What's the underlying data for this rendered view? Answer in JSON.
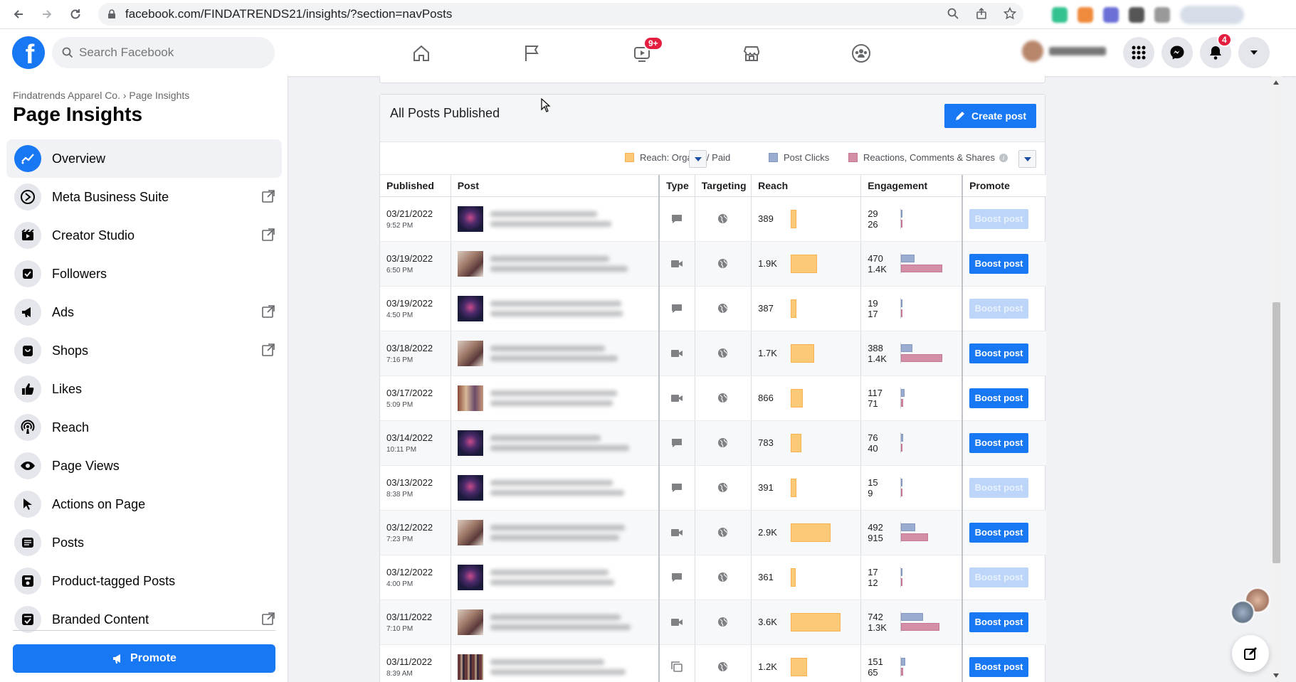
{
  "browser": {
    "url": "facebook.com/FINDATRENDS21/insights/?section=navPosts"
  },
  "topnav": {
    "search_placeholder": "Search Facebook",
    "watch_badge": "9+",
    "notif_badge": "4",
    "logo_letter": "f"
  },
  "sidebar": {
    "breadcrumb": "Findatrends Apparel Co. › Page Insights",
    "title": "Page Insights",
    "items": [
      {
        "label": "Overview",
        "icon": "overview-icon",
        "external": false,
        "active": true
      },
      {
        "label": "Meta Business Suite",
        "icon": "business-suite-icon",
        "external": true,
        "active": false
      },
      {
        "label": "Creator Studio",
        "icon": "creator-studio-icon",
        "external": true,
        "active": false
      },
      {
        "label": "Followers",
        "icon": "followers-icon",
        "external": false,
        "active": false
      },
      {
        "label": "Ads",
        "icon": "megaphone-icon",
        "external": true,
        "active": false
      },
      {
        "label": "Shops",
        "icon": "shop-icon",
        "external": true,
        "active": false
      },
      {
        "label": "Likes",
        "icon": "thumbs-up-icon",
        "external": false,
        "active": false
      },
      {
        "label": "Reach",
        "icon": "reach-icon",
        "external": false,
        "active": false
      },
      {
        "label": "Page Views",
        "icon": "eye-icon",
        "external": false,
        "active": false
      },
      {
        "label": "Actions on Page",
        "icon": "cursor-icon",
        "external": false,
        "active": false
      },
      {
        "label": "Posts",
        "icon": "posts-icon",
        "external": false,
        "active": false
      },
      {
        "label": "Product-tagged Posts",
        "icon": "product-tag-icon",
        "external": false,
        "active": false
      },
      {
        "label": "Branded Content",
        "icon": "branded-content-icon",
        "external": true,
        "active": false
      }
    ],
    "promote_label": "Promote"
  },
  "posts_card": {
    "title": "All Posts Published",
    "create_label": "Create post",
    "legend": {
      "reach": "Reach: Organic / Paid",
      "clicks": "Post Clicks",
      "reactions": "Reactions, Comments & Shares"
    },
    "columns": {
      "published": "Published",
      "post": "Post",
      "type": "Type",
      "targeting": "Targeting",
      "reach": "Reach",
      "engagement": "Engagement",
      "promote": "Promote"
    },
    "boost_label": "Boost post",
    "reach_max": 3600,
    "eng_max": 1400,
    "rows": [
      {
        "date": "03/21/2022",
        "time": "9:52 PM",
        "thumb": "logo",
        "type": "status",
        "reach": "389",
        "reach_val": 389,
        "eng1": "29",
        "eng2": "26",
        "e1": 29,
        "e2": 26,
        "boost_enabled": false
      },
      {
        "date": "03/19/2022",
        "time": "6:50 PM",
        "thumb": "person",
        "type": "video",
        "reach": "1.9K",
        "reach_val": 1900,
        "eng1": "470",
        "eng2": "1.4K",
        "e1": 470,
        "e2": 1400,
        "boost_enabled": true
      },
      {
        "date": "03/19/2022",
        "time": "4:50 PM",
        "thumb": "logo",
        "type": "status",
        "reach": "387",
        "reach_val": 387,
        "eng1": "19",
        "eng2": "17",
        "e1": 19,
        "e2": 17,
        "boost_enabled": false
      },
      {
        "date": "03/18/2022",
        "time": "7:16 PM",
        "thumb": "person",
        "type": "video",
        "reach": "1.7K",
        "reach_val": 1700,
        "eng1": "388",
        "eng2": "1.4K",
        "e1": 388,
        "e2": 1400,
        "boost_enabled": true
      },
      {
        "date": "03/17/2022",
        "time": "5:09 PM",
        "thumb": "group",
        "type": "video",
        "reach": "866",
        "reach_val": 866,
        "eng1": "117",
        "eng2": "71",
        "e1": 117,
        "e2": 71,
        "boost_enabled": true
      },
      {
        "date": "03/14/2022",
        "time": "10:11 PM",
        "thumb": "logo",
        "type": "status",
        "reach": "783",
        "reach_val": 783,
        "eng1": "76",
        "eng2": "40",
        "e1": 76,
        "e2": 40,
        "boost_enabled": true
      },
      {
        "date": "03/13/2022",
        "time": "8:38 PM",
        "thumb": "logo",
        "type": "status",
        "reach": "391",
        "reach_val": 391,
        "eng1": "15",
        "eng2": "9",
        "e1": 15,
        "e2": 9,
        "boost_enabled": false
      },
      {
        "date": "03/12/2022",
        "time": "7:23 PM",
        "thumb": "person",
        "type": "video",
        "reach": "2.9K",
        "reach_val": 2900,
        "eng1": "492",
        "eng2": "915",
        "e1": 492,
        "e2": 915,
        "boost_enabled": true
      },
      {
        "date": "03/12/2022",
        "time": "4:00 PM",
        "thumb": "logo",
        "type": "status",
        "reach": "361",
        "reach_val": 361,
        "eng1": "17",
        "eng2": "12",
        "e1": 17,
        "e2": 12,
        "boost_enabled": false
      },
      {
        "date": "03/11/2022",
        "time": "7:10 PM",
        "thumb": "person",
        "type": "video",
        "reach": "3.6K",
        "reach_val": 3600,
        "eng1": "742",
        "eng2": "1.3K",
        "e1": 742,
        "e2": 1300,
        "boost_enabled": true
      },
      {
        "date": "03/11/2022",
        "time": "8:39 AM",
        "thumb": "rack",
        "type": "album",
        "reach": "1.2K",
        "reach_val": 1200,
        "eng1": "151",
        "eng2": "65",
        "e1": 151,
        "e2": 65,
        "boost_enabled": true
      }
    ]
  },
  "colors": {
    "fb_blue": "#1877f2",
    "reach_bar": "#fcc978",
    "clicks_bar": "#9aaccf",
    "reactions_bar": "#d28fa6"
  }
}
